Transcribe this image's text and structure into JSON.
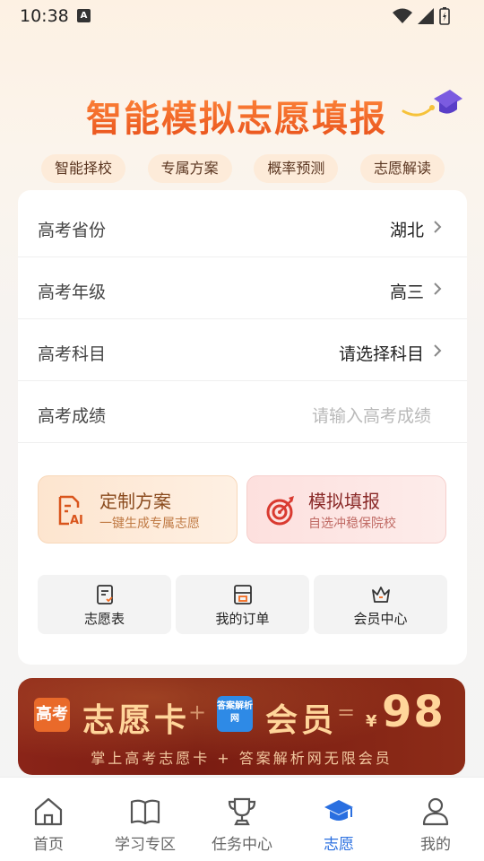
{
  "status_bar": {
    "time": "10:38",
    "notif_letter": "A"
  },
  "hero": {
    "title": "智能模拟志愿填报"
  },
  "feature_tags": [
    "智能择校",
    "专属方案",
    "概率预测",
    "志愿解读"
  ],
  "form": {
    "province": {
      "label": "高考省份",
      "value": "湖北"
    },
    "grade": {
      "label": "高考年级",
      "value": "高三"
    },
    "subject": {
      "label": "高考科目",
      "value": "请选择科目"
    },
    "score": {
      "label": "高考成绩",
      "placeholder": "请输入高考成绩"
    }
  },
  "actions": {
    "custom": {
      "title": "定制方案",
      "subtitle": "一键生成专属志愿"
    },
    "simulate": {
      "title": "模拟填报",
      "subtitle": "自选冲稳保院校"
    }
  },
  "quick_links": [
    {
      "label": "志愿表",
      "icon": "volunteer-list-icon"
    },
    {
      "label": "我的订单",
      "icon": "order-icon"
    },
    {
      "label": "会员中心",
      "icon": "crown-icon"
    }
  ],
  "banner": {
    "logo1": "高考",
    "text1": "志愿卡",
    "plus": "+",
    "logo2": "答案解析网",
    "text2": "会员",
    "equals": "=",
    "currency": "¥",
    "price": "98",
    "subtitle": "掌上高考志愿卡 + 答案解析网无限会员"
  },
  "nav": [
    {
      "label": "首页",
      "icon": "home-icon",
      "active": false
    },
    {
      "label": "学习专区",
      "icon": "book-icon",
      "active": false
    },
    {
      "label": "任务中心",
      "icon": "trophy-icon",
      "active": false
    },
    {
      "label": "志愿",
      "icon": "graduation-cap-icon",
      "active": true
    },
    {
      "label": "我的",
      "icon": "user-icon",
      "active": false
    }
  ],
  "colors": {
    "accent": "#2a6fe0",
    "hero": "#f26a1f",
    "banner": "#8a2418"
  }
}
